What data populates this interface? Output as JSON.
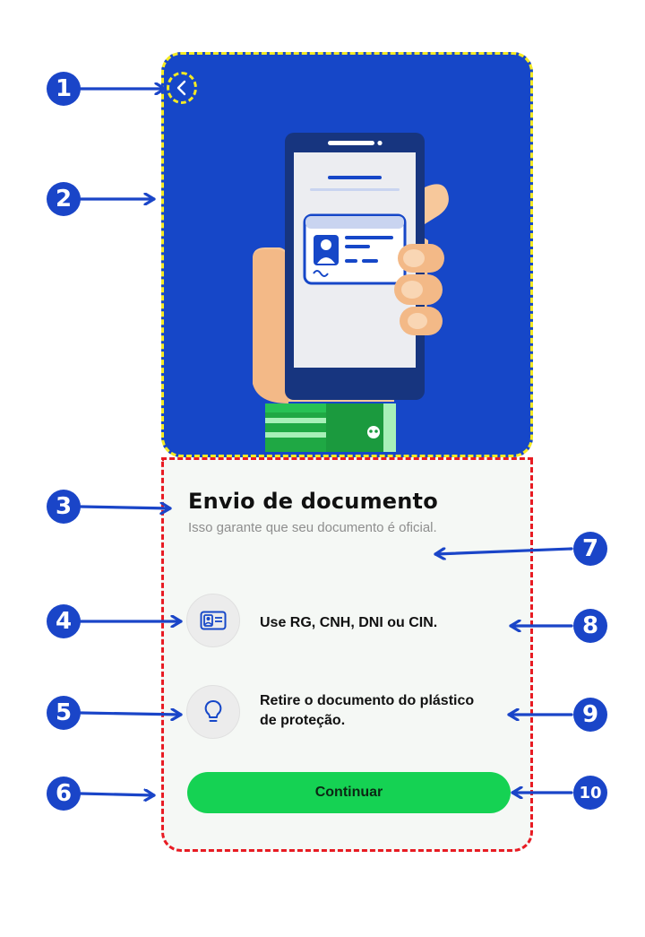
{
  "colors": {
    "hero_background": "#1647c8",
    "hero_border": "#f4ea24",
    "card_border": "#e81b23",
    "primary_button": "#15d253",
    "marker": "#1a45c8"
  },
  "header": {
    "back_icon": "chevron-left-icon"
  },
  "hero": {
    "illustration": "hand-holding-phone-with-id-card"
  },
  "card": {
    "title": "Envio de documento",
    "subtitle": "Isso garante que seu documento é oficial.",
    "tips": [
      {
        "icon": "id-card-icon",
        "text": "Use RG, CNH, DNI ou CIN."
      },
      {
        "icon": "lightbulb-icon",
        "text": "Retire o documento do plástico de proteção."
      }
    ],
    "continue_label": "Continuar"
  },
  "annotations": [
    "1",
    "2",
    "3",
    "4",
    "5",
    "6",
    "7",
    "8",
    "9",
    "10"
  ]
}
